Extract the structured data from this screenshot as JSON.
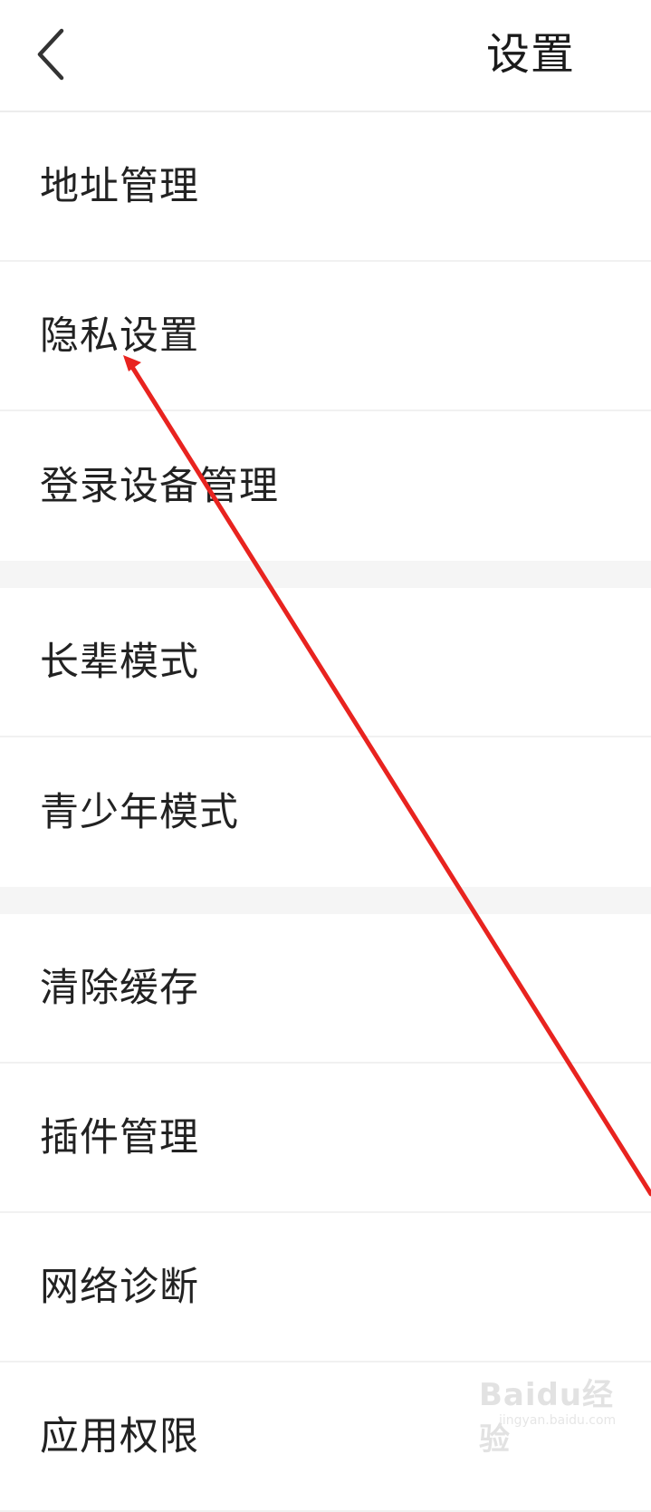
{
  "header": {
    "title": "设置",
    "back_icon": "chevron-left-icon"
  },
  "settings": {
    "groups": [
      {
        "items": [
          {
            "label": "地址管理"
          },
          {
            "label": "隐私设置"
          },
          {
            "label": "登录设备管理"
          }
        ]
      },
      {
        "items": [
          {
            "label": "长辈模式"
          },
          {
            "label": "青少年模式"
          }
        ]
      },
      {
        "items": [
          {
            "label": "清除缓存"
          },
          {
            "label": "插件管理"
          },
          {
            "label": "网络诊断"
          },
          {
            "label": "应用权限"
          }
        ]
      }
    ]
  },
  "annotation": {
    "type": "arrow",
    "color": "#e8231f",
    "target": "隐私设置"
  },
  "watermark": {
    "text": "Baidu经验",
    "subtext": "jingyan.baidu.com"
  }
}
